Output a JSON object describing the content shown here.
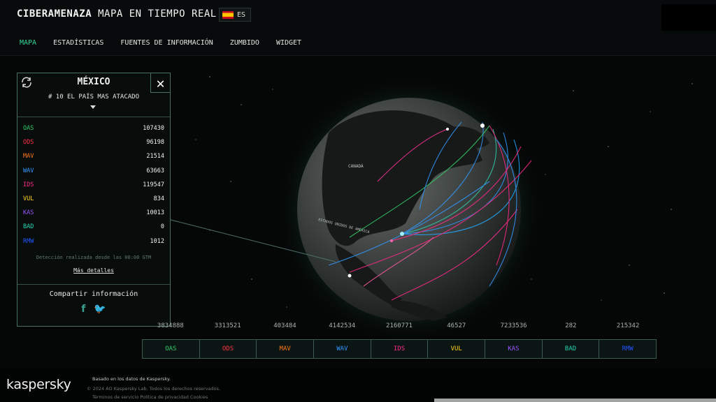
{
  "header": {
    "brand_bold": "CIBERAMENAZA",
    "brand_rest": "MAPA EN TIEMPO REAL",
    "lang": "ES"
  },
  "nav": [
    {
      "label": "MAPA",
      "active": true
    },
    {
      "label": "ESTADÍSTICAS"
    },
    {
      "label": "FUENTES DE INFORMACIÓN"
    },
    {
      "label": "ZUMBIDO"
    },
    {
      "label": "WIDGET"
    }
  ],
  "panel": {
    "country": "MÉXICO",
    "rank": "# 10 EL PAÍS MAS ATACADO",
    "stats": [
      {
        "label": "OAS",
        "value": "107430",
        "color": "#33cc66"
      },
      {
        "label": "ODS",
        "value": "96198",
        "color": "#ff3344"
      },
      {
        "label": "MAV",
        "value": "21514",
        "color": "#ff7a1a"
      },
      {
        "label": "WAV",
        "value": "63663",
        "color": "#3399ff"
      },
      {
        "label": "IDS",
        "value": "119547",
        "color": "#ff2a8a"
      },
      {
        "label": "VUL",
        "value": "834",
        "color": "#ffd21a"
      },
      {
        "label": "KAS",
        "value": "10013",
        "color": "#9955ff"
      },
      {
        "label": "BAD",
        "value": "0",
        "color": "#22d4b0"
      },
      {
        "label": "RMW",
        "value": "1012",
        "color": "#2255ff"
      }
    ],
    "detection_note": "Detección realizada desde las 00:00 GTM",
    "more_link": "Más detalles",
    "share_title": "Compartir información",
    "share_icons": [
      "facebook-icon",
      "twitter-icon"
    ]
  },
  "totals": [
    "3834888",
    "3313521",
    "403484",
    "4142534",
    "2160771",
    "46527",
    "7233536",
    "282",
    "215342"
  ],
  "legend": [
    {
      "label": "OAS",
      "color": "#33cc66"
    },
    {
      "label": "ODS",
      "color": "#ff3344"
    },
    {
      "label": "MAV",
      "color": "#ff7a1a"
    },
    {
      "label": "WAV",
      "color": "#3399ff"
    },
    {
      "label": "IDS",
      "color": "#ff2a8a"
    },
    {
      "label": "VUL",
      "color": "#ffd21a"
    },
    {
      "label": "KAS",
      "color": "#9955ff"
    },
    {
      "label": "BAD",
      "color": "#22d4b0"
    },
    {
      "label": "RMW",
      "color": "#2255ff"
    }
  ],
  "globe_labels": [
    "CANADÁ",
    "ESTADOS UNIDOS DE AMÉRICA"
  ],
  "footer": {
    "logo": "kaspersky",
    "line1": "Basado en los datos de Kaspersky.",
    "line2": "© 2024 AO Kaspersky Lab. Todos los derechos reservados.",
    "line3": "Términos de servicio Política de privacidad Cookies"
  }
}
